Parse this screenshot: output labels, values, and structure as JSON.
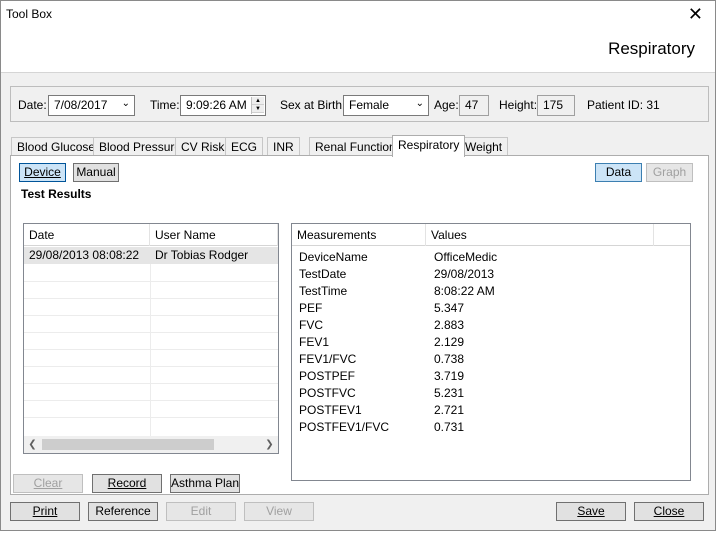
{
  "window": {
    "title": "Tool Box",
    "section_title": "Respiratory",
    "close_icon": "close-icon"
  },
  "filters": {
    "date_label": "Date:",
    "date_value": "7/08/2017",
    "time_label": "Time:",
    "time_value": "9:09:26 AM",
    "sex_label": "Sex at Birth:",
    "sex_value": "Female",
    "age_label": "Age:",
    "age_value": "47",
    "height_label": "Height:",
    "height_value": "175",
    "patient_id": "Patient ID: 31"
  },
  "tabs": [
    {
      "label": "Blood Glucose"
    },
    {
      "label": "Blood Pressure"
    },
    {
      "label": "CV Risk"
    },
    {
      "label": "ECG"
    },
    {
      "label": "INR"
    },
    {
      "label": "Renal Function"
    },
    {
      "label": "Respiratory"
    },
    {
      "label": "Weight"
    }
  ],
  "active_tab": "Respiratory",
  "panel": {
    "device_label": "Device",
    "manual_label": "Manual",
    "data_label": "Data",
    "graph_label": "Graph",
    "results_heading": "Test Results",
    "results_columns": [
      "Date",
      "User Name"
    ],
    "results_rows": [
      {
        "date": "29/08/2013 08:08:22",
        "user": "Dr Tobias Rodger"
      }
    ],
    "measure_columns": [
      "Measurements",
      "Values"
    ],
    "measurements": [
      {
        "name": "DeviceName",
        "value": "OfficeMedic"
      },
      {
        "name": "TestDate",
        "value": "29/08/2013"
      },
      {
        "name": "TestTime",
        "value": "8:08:22 AM"
      },
      {
        "name": "PEF",
        "value": "5.347"
      },
      {
        "name": "FVC",
        "value": "2.883"
      },
      {
        "name": "FEV1",
        "value": "2.129"
      },
      {
        "name": "FEV1/FVC",
        "value": "0.738"
      },
      {
        "name": "POSTPEF",
        "value": "3.719"
      },
      {
        "name": "POSTFVC",
        "value": "5.231"
      },
      {
        "name": "POSTFEV1",
        "value": "2.721"
      },
      {
        "name": "POSTFEV1/FVC",
        "value": "0.731"
      }
    ],
    "clear_label": "Clear",
    "record_label": "Record",
    "asthma_label": "Asthma Plan"
  },
  "footer": {
    "print_label": "Print",
    "reference_label": "Reference",
    "edit_label": "Edit",
    "view_label": "View",
    "save_label": "Save",
    "close_label": "Close"
  }
}
